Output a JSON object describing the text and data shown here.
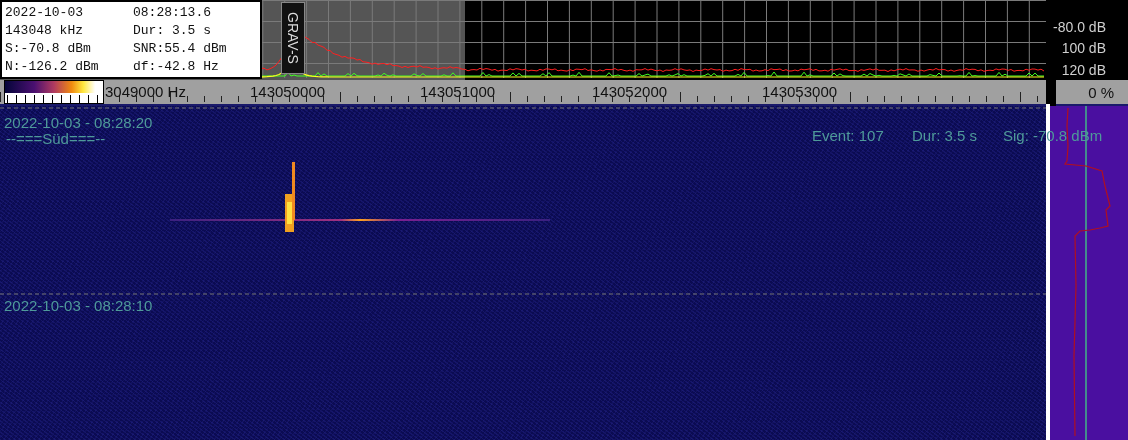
{
  "info_box": {
    "rows": [
      {
        "left": "2022-10-03",
        "right": "08:28:13.6"
      },
      {
        "left": "143048 kHz",
        "right": "Dur: 3.5 s"
      },
      {
        "left": "S:-70.8 dBm",
        "right": "SNR:55.4 dBm"
      },
      {
        "left": "N:-126.2 dBm",
        "right": "df:-42.8 Hz"
      }
    ]
  },
  "signal_label": "GRAV-S",
  "db_scale": [
    "-80.0 dB",
    "100 dB",
    "120 dB"
  ],
  "frequency_axis": {
    "labels": [
      "3049000 Hz",
      "143050000",
      "143051000",
      "143052000",
      "143053000"
    ]
  },
  "level_readout": "0 %",
  "waterfall": {
    "markers": [
      {
        "time": "2022-10-03 - 08:28:20",
        "caption": "--===Süd===--"
      },
      {
        "time": "2022-10-03 - 08:28:10"
      }
    ],
    "event": {
      "number": "Event: 107",
      "duration": "Dur: 3.5 s",
      "signal": "Sig: -70.8 dBm"
    }
  }
}
